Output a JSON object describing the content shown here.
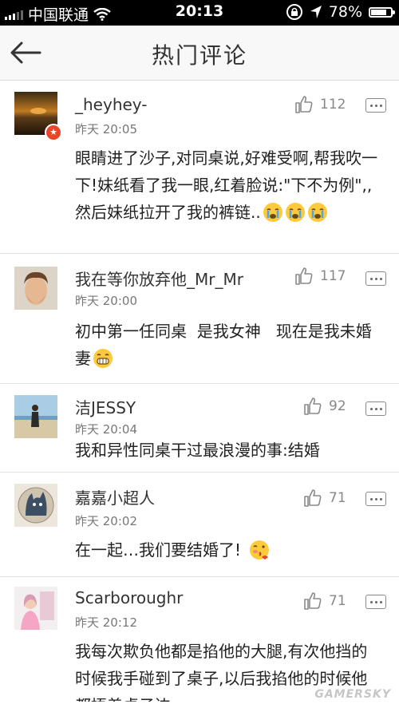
{
  "status_bar": {
    "carrier": "中国联通",
    "time": "20:13",
    "battery": "78%",
    "battery_level": 0.78,
    "icons": [
      "signal-icon",
      "wifi-icon",
      "rotation-lock-icon",
      "location-arrow-icon",
      "battery-icon"
    ]
  },
  "navbar": {
    "back_icon": "back-arrow-icon",
    "title": "热门评论"
  },
  "comments": [
    {
      "user": "_heyhey-",
      "time": "昨天 20:05",
      "likes": "112",
      "text": "眼睛进了沙子,对同桌说,好难受啊,帮我吹一下!妹纸看了我一眼,红着脸说:\"下不为例\",,然后妹纸拉开了我的裤链..",
      "emoji": [
        "crying-face-emoji",
        "crying-face-emoji",
        "crying-face-emoji"
      ],
      "verified_badge": true
    },
    {
      "user": "我在等你放弃他_Mr_Mr",
      "time": "昨天 20:00",
      "likes": "117",
      "text": "初中第一任同桌  是我女神   现在是我未婚妻",
      "emoji": [
        "grinning-face-emoji"
      ]
    },
    {
      "user": "洁JESSY",
      "time": "昨天 20:04",
      "likes": "92",
      "text": "我和异性同桌干过最浪漫的事:结婚"
    },
    {
      "user": "嘉嘉小超人",
      "time": "昨天 20:02",
      "likes": "71",
      "text": "在一起…我们要结婚了!",
      "emoji": [
        "kissing-face-emoji"
      ]
    },
    {
      "user": "Scarboroughr",
      "time": "昨天 20:12",
      "likes": "71",
      "text": "我每次欺负他都是掐他的大腿,有次他挡的时候我手碰到了桌子,以后我掐他的时候他都捂着桌子边"
    }
  ],
  "watermark": "GAMERSKY",
  "colors": {
    "badge": "#e8452a",
    "emoji_face": "#ffc93c",
    "navbar_bg": "#f8f8f8"
  }
}
